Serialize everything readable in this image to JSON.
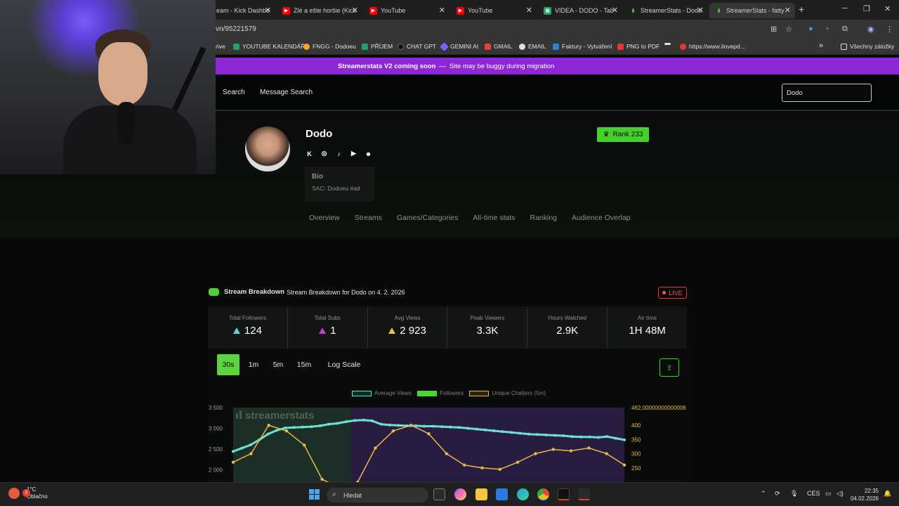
{
  "browser": {
    "tabs": [
      {
        "label": "eam - Kick Dashbo",
        "icon": "kick-icon",
        "color": "#53fc18"
      },
      {
        "label": "Zlé a ešte horšie (Kick",
        "icon": "youtube-icon",
        "color": "#ff0000"
      },
      {
        "label": "YouTube",
        "icon": "youtube-icon",
        "color": "#ff0000"
      },
      {
        "label": "YouTube",
        "icon": "youtube-icon",
        "color": "#ff0000"
      },
      {
        "label": "VIDEA - DODO - Tab",
        "icon": "sheets-icon",
        "color": "#1fa463"
      },
      {
        "label": "StreamerStats - Dodo",
        "icon": "streamerstats-icon",
        "color": "#4cd137"
      },
      {
        "label": "StreamerStats - fatty",
        "icon": "streamerstats-icon",
        "color": "#4cd137"
      }
    ],
    "url": "vn/95221579",
    "bookmarks": [
      {
        "label": "rive",
        "color": "#4caf50"
      },
      {
        "label": "YOUTUBE KALENDÁŘ",
        "color": "#1fa463"
      },
      {
        "label": "FNGG - Dodoeu",
        "color": "#f5a623"
      },
      {
        "label": "PŘÍJEM",
        "color": "#1fa463"
      },
      {
        "label": "CHAT GPT",
        "color": "#111111"
      },
      {
        "label": "GEMINI AI",
        "color": "#7b61ff"
      },
      {
        "label": "GMAIL",
        "color": "#ea4335"
      },
      {
        "label": "EMAIL",
        "color": "#e0e0e0"
      },
      {
        "label": "Faktury - Vytváření",
        "color": "#2b83d6"
      },
      {
        "label": "PNG to PDF",
        "color": "#e53935"
      },
      {
        "label": "",
        "color": "#e0e0e0"
      },
      {
        "label": "https://www.ilovepd...",
        "color": "#e53935"
      }
    ],
    "bookmarks_more": "»",
    "all_bookmarks": "Všechny záložky"
  },
  "site": {
    "banner_title": "Streamerstats V2 coming soon",
    "banner_sep": "—",
    "banner_text": "Site may be buggy during migration",
    "nav": {
      "search": "Search",
      "message_search": "Message Search"
    },
    "search_value": "Dodo"
  },
  "profile": {
    "name": "Dodo",
    "rank": "Rank 233",
    "socials": [
      "kick-icon",
      "instagram-icon",
      "tiktok-icon",
      "youtube-icon",
      "discord-icon"
    ],
    "bio_title": "Bio",
    "bio_text": "SAC: Dodoeu #ad",
    "tabs": [
      "Overview",
      "Streams",
      "Games/Categories",
      "All-time stats",
      "Ranking",
      "Audience Overlap"
    ]
  },
  "breakdown": {
    "title": "Stream Breakdown",
    "subtitle": "Stream Breakdown for Dodo on 4. 2. 2026",
    "live": "LIVE",
    "stats": [
      {
        "label": "Total Followers",
        "value": "124",
        "trend": "up"
      },
      {
        "label": "Total Subs",
        "value": "1",
        "trend": "up"
      },
      {
        "label": "Avg Views",
        "value": "2 923",
        "trend": "up"
      },
      {
        "label": "Peak Viewers",
        "value": "3.3K"
      },
      {
        "label": "Hours Watched",
        "value": "2.9K"
      },
      {
        "label": "Air time",
        "value": "1H 48M"
      }
    ],
    "intervals": [
      "30s",
      "1m",
      "5m",
      "15m",
      "Log Scale"
    ],
    "active_interval": "30s"
  },
  "chart_data": {
    "type": "line",
    "watermark": "streamerstats",
    "legend": [
      "Average Views",
      "Followers",
      "Unique Chatters (5m)"
    ],
    "series_colors": {
      "Average Views": "#6ee0d2",
      "Followers": "#4cd137",
      "Unique Chatters (5m)": "#e8b84a"
    },
    "y_left_ticks": [
      "3 500",
      "3 000",
      "2 500",
      "2 000"
    ],
    "y_right_ticks": [
      "462,00000000000006",
      "400",
      "350",
      "300",
      "250"
    ],
    "y_left_range": [
      1700,
      3500
    ],
    "y_right_range": [
      200,
      462
    ],
    "series": [
      {
        "name": "Average Views",
        "axis": "left",
        "values": [
          2440,
          2520,
          2600,
          2720,
          2860,
          2950,
          3010,
          3020,
          3030,
          3040,
          3060,
          3100,
          3120,
          3160,
          3190,
          3200,
          3180,
          3100,
          3080,
          3070,
          3060,
          3060,
          3050,
          3050,
          3040,
          3030,
          3020,
          3000,
          2980,
          2960,
          2940,
          2920,
          2900,
          2880,
          2860,
          2850,
          2840,
          2830,
          2820,
          2800,
          2790,
          2790,
          2780,
          2800,
          2760,
          2720
        ]
      },
      {
        "name": "Unique Chatters (5m)",
        "axis": "right",
        "values": [
          270,
          300,
          400,
          380,
          330,
          210,
          180,
          200,
          320,
          380,
          400,
          370,
          300,
          260,
          250,
          245,
          270,
          300,
          315,
          310,
          320,
          300,
          260
        ]
      }
    ]
  },
  "taskbar": {
    "weather_temp": "1°C",
    "weather_desc": "Oblačno",
    "notif_count": "2",
    "search_placeholder": "Hledat",
    "lang": "CES",
    "time": "22:35",
    "date": "04.02.2026"
  }
}
